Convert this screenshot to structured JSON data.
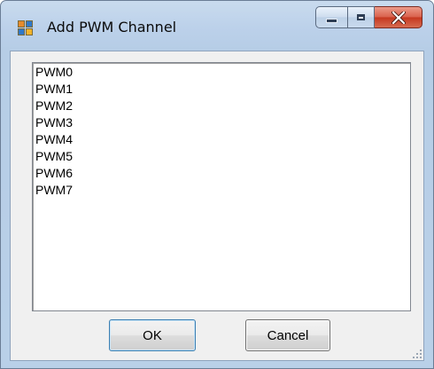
{
  "window": {
    "title": "Add PWM Channel",
    "app_icon": "window-app-icon",
    "caption_buttons": [
      "minimize-icon",
      "maximize-icon",
      "close-icon"
    ]
  },
  "listbox": {
    "items": [
      "PWM0",
      "PWM1",
      "PWM2",
      "PWM3",
      "PWM4",
      "PWM5",
      "PWM6",
      "PWM7"
    ]
  },
  "buttons": {
    "ok": "OK",
    "cancel": "Cancel"
  }
}
